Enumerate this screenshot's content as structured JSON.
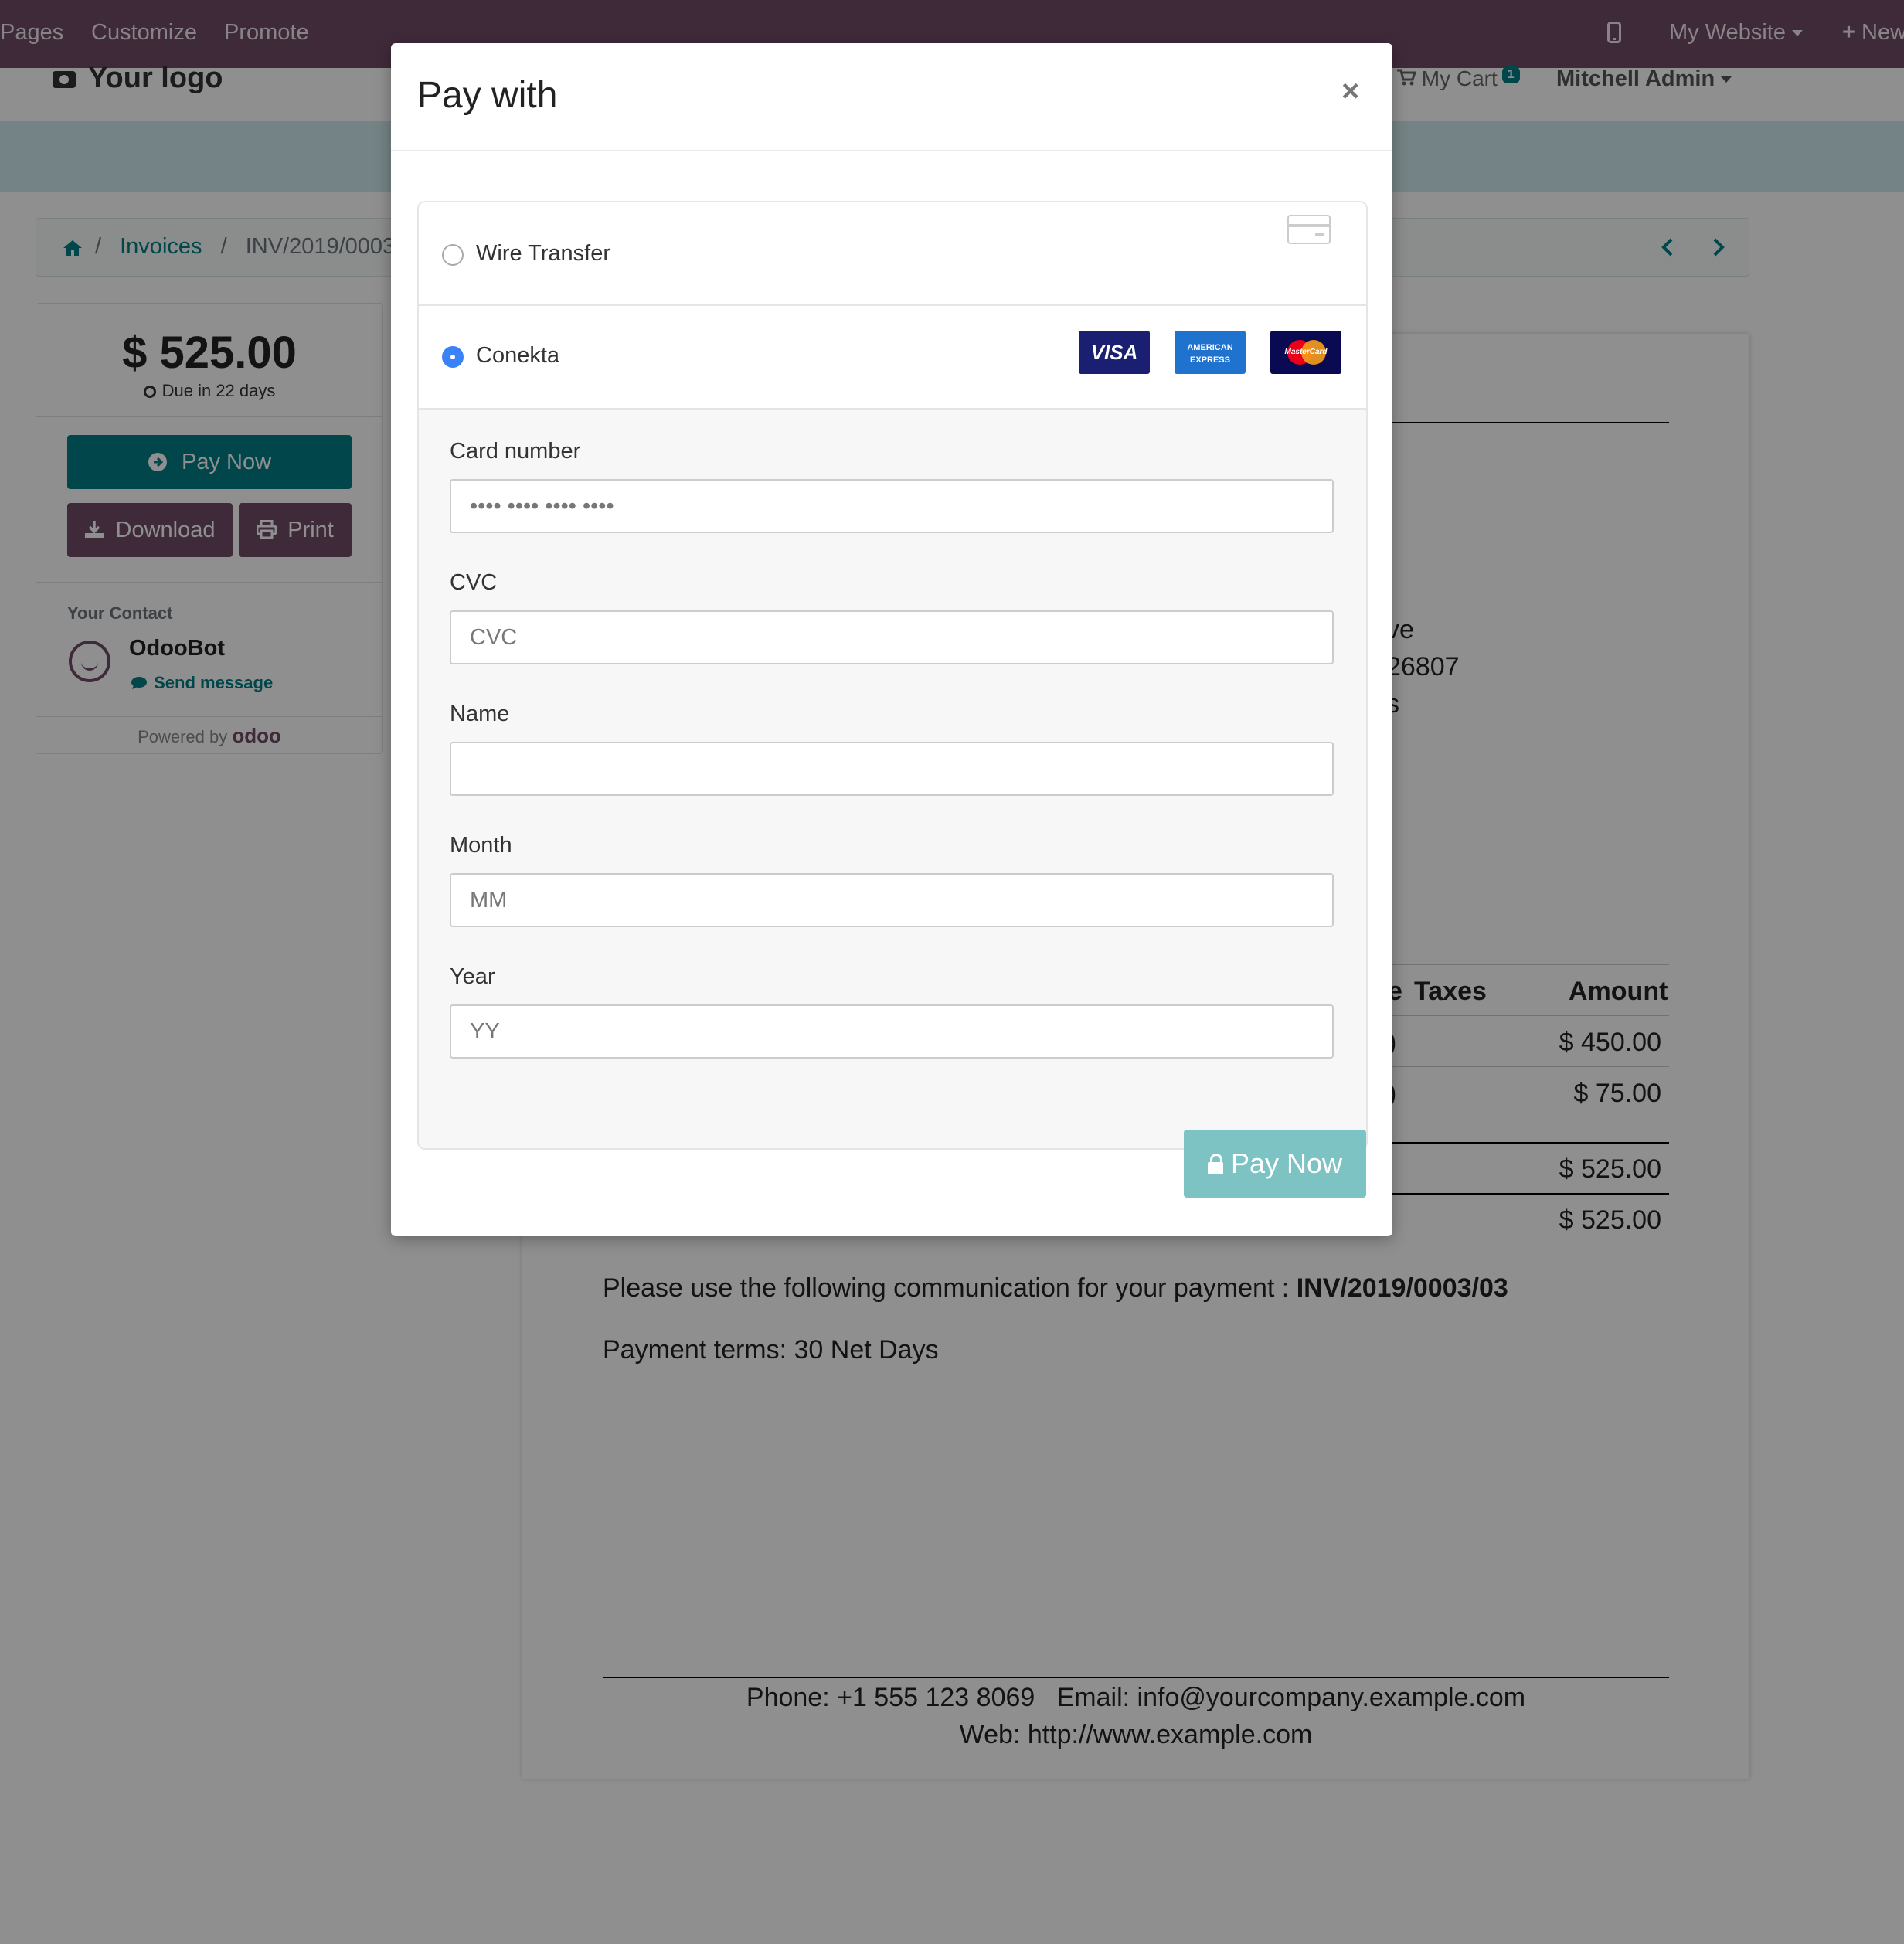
{
  "topbar": {
    "items": [
      "Pages",
      "Customize",
      "Promote"
    ],
    "website": "My Website",
    "new": "New"
  },
  "header": {
    "logo": "Your logo",
    "cart_label": "My Cart",
    "cart_count": "1",
    "user": "Mitchell Admin"
  },
  "breadcrumb": {
    "sep": "/",
    "invoices": "Invoices",
    "current": "INV/2019/0003"
  },
  "sidebar": {
    "amount": "$ 525.00",
    "due": "Due in 22 days",
    "pay_now": "Pay Now",
    "download": "Download",
    "print": "Print",
    "contact_title": "Your Contact",
    "contact_name": "OdooBot",
    "send_message": "Send message",
    "powered_by": "Powered by",
    "odoo": "odoo"
  },
  "invoice": {
    "partial_address": [
      "ve",
      "26807",
      "s"
    ],
    "col_taxes": "Taxes",
    "col_amount": "Amount",
    "partial_col": "e",
    "rows": [
      {
        "partial": ")",
        "amount": "$ 450.00"
      },
      {
        "partial": ")",
        "amount": "$ 75.00"
      }
    ],
    "subtotal": "$ 525.00",
    "total": "$ 525.00",
    "communication_label": "Please use the following communication for your payment :",
    "communication_ref": "INV/2019/0003/03",
    "payment_terms": "Payment terms: 30 Net Days",
    "footer_line1": "Phone: +1 555 123 8069   Email: info@yourcompany.example.com",
    "footer_line2": "Web: http://www.example.com"
  },
  "modal": {
    "title": "Pay with",
    "close": "×",
    "methods": [
      {
        "label": "Wire Transfer",
        "selected": false
      },
      {
        "label": "Conekta",
        "selected": true
      }
    ],
    "card_logos": [
      "VISA",
      "AMERICAN EXPRESS",
      "MasterCard"
    ],
    "fields": {
      "card_number_label": "Card number",
      "card_number_placeholder": "•••• •••• •••• ••••",
      "cvc_label": "CVC",
      "cvc_placeholder": "CVC",
      "name_label": "Name",
      "name_placeholder": "",
      "month_label": "Month",
      "month_placeholder": "MM",
      "year_label": "Year",
      "year_placeholder": "YY"
    },
    "pay_now": "Pay Now"
  },
  "colors": {
    "brand": "#714b67",
    "primary": "#017e84",
    "pay_button_disabled": "#7ec3c4",
    "radio_selected": "#3b82f6"
  },
  "icons": [
    "home-icon",
    "clock-icon",
    "arrow-circle-right-icon",
    "download-icon",
    "print-icon",
    "comment-icon",
    "camera-icon",
    "cart-icon",
    "mobile-icon",
    "plus-icon",
    "chevron-left-icon",
    "chevron-right-icon",
    "lock-icon",
    "credit-card-icon",
    "close-icon"
  ]
}
